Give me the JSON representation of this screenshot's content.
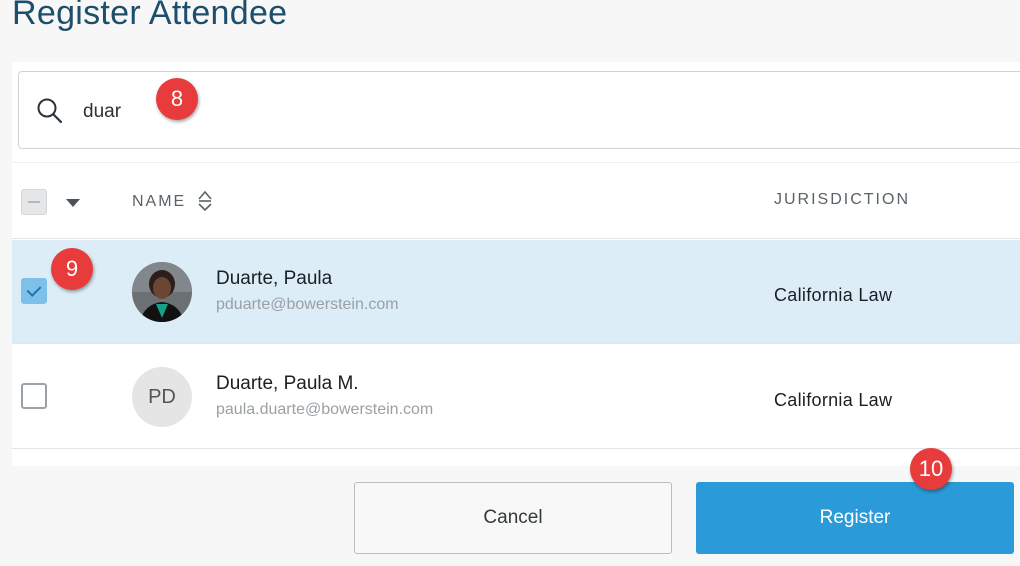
{
  "title": "Register Attendee",
  "search": {
    "value": "duar",
    "placeholder": ""
  },
  "table": {
    "columns": {
      "name": "NAME",
      "jurisdiction": "JURISDICTION"
    },
    "rows": [
      {
        "name": "Duarte, Paula",
        "email": "pduarte@bowerstein.com",
        "jurisdiction": "California Law",
        "selected": true,
        "avatar": "photo"
      },
      {
        "name": "Duarte, Paula M.",
        "email": "paula.duarte@bowerstein.com",
        "jurisdiction": "California Law",
        "selected": false,
        "initials": "PD"
      }
    ]
  },
  "buttons": {
    "cancel": "Cancel",
    "register": "Register"
  },
  "markers": [
    "8",
    "9",
    "10"
  ],
  "colors": {
    "accent": "#2a9ad8",
    "selected_row": "#dcedf7",
    "title": "#1d4e6b",
    "marker": "#e83b3b"
  }
}
